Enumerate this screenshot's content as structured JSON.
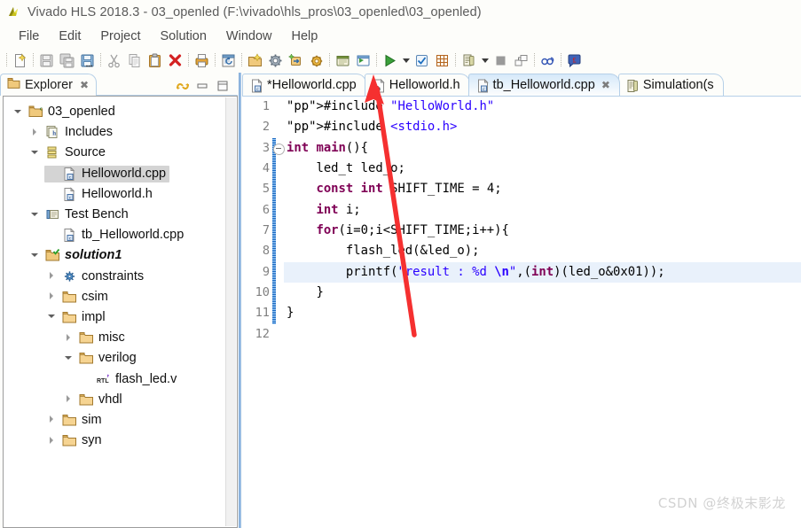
{
  "window": {
    "title": "Vivado HLS 2018.3 - 03_openled (F:\\vivado\\hls_pros\\03_openled\\03_openled)",
    "app_icon": "vivado-logo-icon"
  },
  "menu": {
    "items": [
      {
        "label": "File"
      },
      {
        "label": "Edit"
      },
      {
        "label": "Project"
      },
      {
        "label": "Solution"
      },
      {
        "label": "Window"
      },
      {
        "label": "Help"
      }
    ]
  },
  "toolbar": {
    "buttons": [
      {
        "name": "new-file-icon",
        "enabled": true
      },
      {
        "name": "save-icon",
        "enabled": false
      },
      {
        "name": "save-all-icon",
        "enabled": false
      },
      {
        "name": "save-as-icon",
        "enabled": true
      },
      {
        "name": "cut-icon",
        "enabled": false
      },
      {
        "name": "copy-icon",
        "enabled": false
      },
      {
        "name": "paste-icon",
        "enabled": true
      },
      {
        "name": "delete-icon",
        "enabled": true
      },
      {
        "name": "print-icon",
        "enabled": true
      },
      {
        "name": "refresh-project-icon",
        "enabled": true
      },
      {
        "name": "new-solution-icon",
        "enabled": true
      },
      {
        "name": "project-settings-gear-icon",
        "enabled": true
      },
      {
        "name": "add-directive-icon",
        "enabled": true
      },
      {
        "name": "solution-settings-icon",
        "enabled": true
      },
      {
        "name": "open-report-icon",
        "enabled": true
      },
      {
        "name": "export-rtl-icon",
        "enabled": true
      },
      {
        "name": "run-c-simulation-icon",
        "enabled": true
      },
      {
        "name": "run-dropdown-caret-icon",
        "enabled": true
      },
      {
        "name": "run-c-synthesis-icon",
        "enabled": true
      },
      {
        "name": "run-cosim-grid-icon",
        "enabled": true
      },
      {
        "name": "open-analysis-icon",
        "enabled": true
      },
      {
        "name": "perspective-dropdown-caret-icon",
        "enabled": true
      },
      {
        "name": "stop-icon",
        "enabled": false
      },
      {
        "name": "compare-icon",
        "enabled": true
      },
      {
        "name": "glasses-inspect-icon",
        "enabled": true
      },
      {
        "name": "pound-annotation-icon",
        "enabled": true
      }
    ]
  },
  "explorer": {
    "tab_label": "Explorer",
    "tab_icon": "explorer-view-icon",
    "close_glyph": "✖",
    "tools": [
      {
        "name": "link-with-editor-icon"
      },
      {
        "name": "minimize-view-icon"
      },
      {
        "name": "maximize-view-icon"
      }
    ],
    "tree": [
      {
        "label": "03_openled",
        "indent": 0,
        "twisty": "down",
        "icon": "c-project-icon",
        "bold": false,
        "selected": false
      },
      {
        "label": "Includes",
        "indent": 1,
        "twisty": "right",
        "icon": "includes-icon",
        "bold": false,
        "selected": false
      },
      {
        "label": "Source",
        "indent": 1,
        "twisty": "down",
        "icon": "source-group-icon",
        "bold": false,
        "selected": false
      },
      {
        "label": "Helloworld.cpp",
        "indent": 2,
        "twisty": "none",
        "icon": "cpp-file-icon",
        "bold": false,
        "selected": true
      },
      {
        "label": "Helloworld.h",
        "indent": 2,
        "twisty": "none",
        "icon": "cpp-file-icon",
        "bold": false,
        "selected": false
      },
      {
        "label": "Test Bench",
        "indent": 1,
        "twisty": "down",
        "icon": "testbench-icon",
        "bold": false,
        "selected": false
      },
      {
        "label": "tb_Helloworld.cpp",
        "indent": 2,
        "twisty": "none",
        "icon": "cpp-file-icon",
        "bold": false,
        "selected": false
      },
      {
        "label": "solution1",
        "indent": 1,
        "twisty": "down",
        "icon": "active-solution-icon",
        "bold": true,
        "selected": false
      },
      {
        "label": "constraints",
        "indent": 2,
        "twisty": "right",
        "icon": "constraints-icon",
        "bold": false,
        "selected": false
      },
      {
        "label": "csim",
        "indent": 2,
        "twisty": "right",
        "icon": "folder-icon",
        "bold": false,
        "selected": false
      },
      {
        "label": "impl",
        "indent": 2,
        "twisty": "down",
        "icon": "folder-icon",
        "bold": false,
        "selected": false
      },
      {
        "label": "misc",
        "indent": 3,
        "twisty": "right",
        "icon": "folder-icon",
        "bold": false,
        "selected": false
      },
      {
        "label": "verilog",
        "indent": 3,
        "twisty": "down",
        "icon": "folder-icon",
        "bold": false,
        "selected": false
      },
      {
        "label": "flash_led.v",
        "indent": 4,
        "twisty": "none",
        "icon": "rtl-file-icon",
        "bold": false,
        "selected": false
      },
      {
        "label": "vhdl",
        "indent": 3,
        "twisty": "right",
        "icon": "folder-icon",
        "bold": false,
        "selected": false
      },
      {
        "label": "sim",
        "indent": 2,
        "twisty": "right",
        "icon": "folder-icon",
        "bold": false,
        "selected": false
      },
      {
        "label": "syn",
        "indent": 2,
        "twisty": "right",
        "icon": "folder-icon",
        "bold": false,
        "selected": false
      }
    ]
  },
  "editor": {
    "tabs": [
      {
        "label": "*Helloworld.cpp",
        "icon": "c-file-icon",
        "active": false,
        "closable": false
      },
      {
        "label": "Helloworld.h",
        "icon": "h-file-icon",
        "active": false,
        "closable": false
      },
      {
        "label": "tb_Helloworld.cpp",
        "icon": "c-file-icon",
        "active": true,
        "closable": true
      },
      {
        "label": "Simulation(s",
        "icon": "simulation-icon",
        "active": false,
        "closable": false
      }
    ],
    "close_glyph": "✖",
    "lines": [
      {
        "n": "1",
        "text": "#include \"HelloWorld.h\"",
        "fold": false,
        "hl": false
      },
      {
        "n": "2",
        "text": "#include <stdio.h>",
        "fold": false,
        "hl": false
      },
      {
        "n": "3",
        "text": "int main(){",
        "fold": true,
        "hl": false
      },
      {
        "n": "4",
        "text": "    led_t led_o;",
        "fold": false,
        "hl": false
      },
      {
        "n": "5",
        "text": "    const int SHIFT_TIME = 4;",
        "fold": false,
        "hl": false
      },
      {
        "n": "6",
        "text": "    int i;",
        "fold": false,
        "hl": false
      },
      {
        "n": "7",
        "text": "    for(i=0;i<SHIFT_TIME;i++){",
        "fold": false,
        "hl": false
      },
      {
        "n": "8",
        "text": "        flash_led(&led_o);",
        "fold": false,
        "hl": false
      },
      {
        "n": "9",
        "text": "        printf(\"result : %d \\n\",(int)(led_o&0x01));",
        "fold": false,
        "hl": true
      },
      {
        "n": "10",
        "text": "    }",
        "fold": false,
        "hl": false
      },
      {
        "n": "11",
        "text": "}",
        "fold": false,
        "hl": false
      },
      {
        "n": "12",
        "text": "",
        "fold": false,
        "hl": false
      }
    ]
  },
  "watermark": {
    "text": "CSDN @终极末影龙"
  },
  "annotation": {
    "name": "red-arrow",
    "color": "#f53030"
  },
  "colors": {
    "accent": "#2a6fbf",
    "keyword": "#7f0055",
    "string": "#2a00ff",
    "tab_active": "#d6e9f9",
    "selection": "#d4d4d4",
    "line_highlight": "#e9f1fb"
  }
}
